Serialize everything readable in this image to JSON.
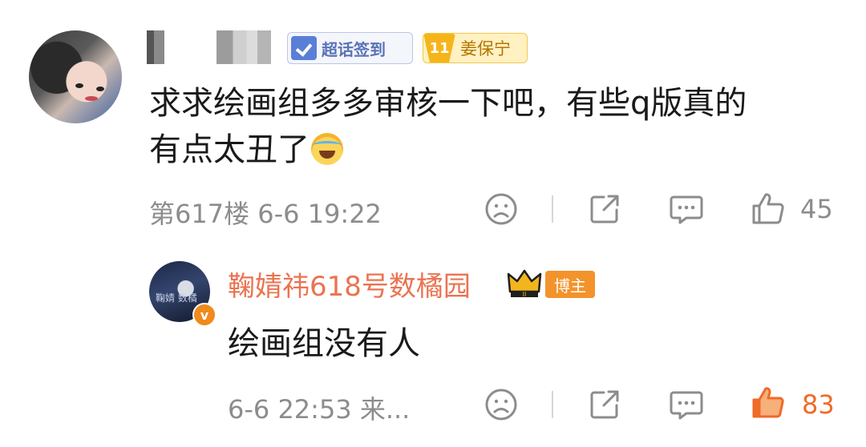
{
  "comment": {
    "text_line1": "求求绘画组多多审核一下吧，有些q版真的",
    "text_line2": "有点太丑了",
    "supertopic_badge": "超话签到",
    "fan_level": "11",
    "fan_name": "姜保宁",
    "floor_time": "第617楼  6-6 19:22",
    "like_count": "45",
    "emoji": "laughing-crying-emoji"
  },
  "reply": {
    "author": "鞠婧祎618号数橘园",
    "badge_level": "II",
    "role_badge": "博主",
    "verified_mark": "v",
    "avatar_text": "鞠婧 数橘",
    "text": "绘画组没有人",
    "time": "6-6 22:53 来...",
    "like_count": "83"
  },
  "colors": {
    "meta_gray": "#8c8c8c",
    "name_orange": "#eb7350",
    "liked_orange": "#f06a28",
    "badge_orange": "#f3932b"
  }
}
